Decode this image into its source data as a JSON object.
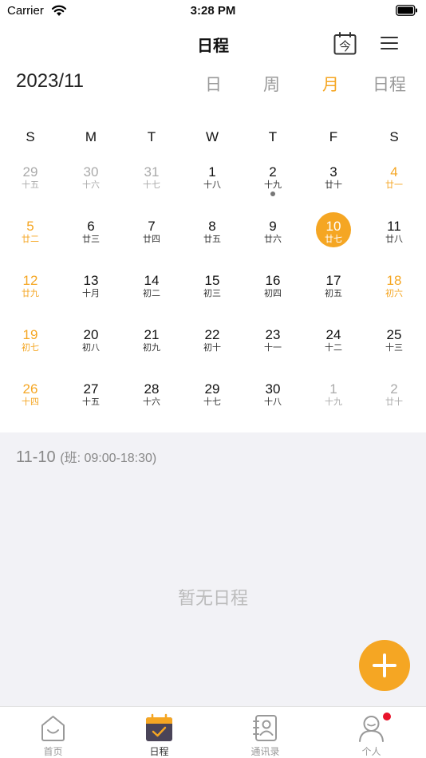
{
  "status_bar": {
    "carrier": "Carrier",
    "time": "3:28 PM"
  },
  "nav": {
    "title": "日程",
    "today_icon_char": "今"
  },
  "header": {
    "month": "2023/11",
    "views": [
      {
        "label": "日",
        "active": false
      },
      {
        "label": "周",
        "active": false
      },
      {
        "label": "月",
        "active": true
      },
      {
        "label": "日程",
        "active": false
      }
    ]
  },
  "calendar": {
    "weekdays": [
      "S",
      "M",
      "T",
      "W",
      "T",
      "F",
      "S"
    ],
    "weeks": [
      [
        {
          "day": "29",
          "lunar": "十五",
          "other": true
        },
        {
          "day": "30",
          "lunar": "十六",
          "other": true
        },
        {
          "day": "31",
          "lunar": "十七",
          "other": true
        },
        {
          "day": "1",
          "lunar": "十八"
        },
        {
          "day": "2",
          "lunar": "十九",
          "event": true
        },
        {
          "day": "3",
          "lunar": "廿十"
        },
        {
          "day": "4",
          "lunar": "廿一",
          "weekend": true
        }
      ],
      [
        {
          "day": "5",
          "lunar": "廿二",
          "weekend": true
        },
        {
          "day": "6",
          "lunar": "廿三"
        },
        {
          "day": "7",
          "lunar": "廿四"
        },
        {
          "day": "8",
          "lunar": "廿五"
        },
        {
          "day": "9",
          "lunar": "廿六"
        },
        {
          "day": "10",
          "lunar": "廿七",
          "selected": true
        },
        {
          "day": "11",
          "lunar": "廿八"
        }
      ],
      [
        {
          "day": "12",
          "lunar": "廿九",
          "weekend": true
        },
        {
          "day": "13",
          "lunar": "十月"
        },
        {
          "day": "14",
          "lunar": "初二"
        },
        {
          "day": "15",
          "lunar": "初三"
        },
        {
          "day": "16",
          "lunar": "初四"
        },
        {
          "day": "17",
          "lunar": "初五"
        },
        {
          "day": "18",
          "lunar": "初六",
          "weekend": true
        }
      ],
      [
        {
          "day": "19",
          "lunar": "初七",
          "weekend": true
        },
        {
          "day": "20",
          "lunar": "初八"
        },
        {
          "day": "21",
          "lunar": "初九"
        },
        {
          "day": "22",
          "lunar": "初十"
        },
        {
          "day": "23",
          "lunar": "十一"
        },
        {
          "day": "24",
          "lunar": "十二"
        },
        {
          "day": "25",
          "lunar": "十三"
        }
      ],
      [
        {
          "day": "26",
          "lunar": "十四",
          "weekend": true
        },
        {
          "day": "27",
          "lunar": "十五"
        },
        {
          "day": "28",
          "lunar": "十六"
        },
        {
          "day": "29",
          "lunar": "十七"
        },
        {
          "day": "30",
          "lunar": "十八"
        },
        {
          "day": "1",
          "lunar": "十九",
          "other": true
        },
        {
          "day": "2",
          "lunar": "廿十",
          "other": true
        }
      ]
    ]
  },
  "schedule": {
    "date": "11-10",
    "shift": "(班: 09:00-18:30)",
    "empty_text": "暂无日程"
  },
  "tabbar": {
    "items": [
      {
        "label": "首页",
        "icon": "home-icon",
        "active": false
      },
      {
        "label": "日程",
        "icon": "calendar-icon",
        "active": true
      },
      {
        "label": "通讯录",
        "icon": "contacts-icon",
        "active": false
      },
      {
        "label": "个人",
        "icon": "profile-icon",
        "active": false,
        "badge": true
      }
    ]
  },
  "colors": {
    "accent": "#F5A623",
    "badge": "#E8132B",
    "panel": "#F2F2F6"
  }
}
